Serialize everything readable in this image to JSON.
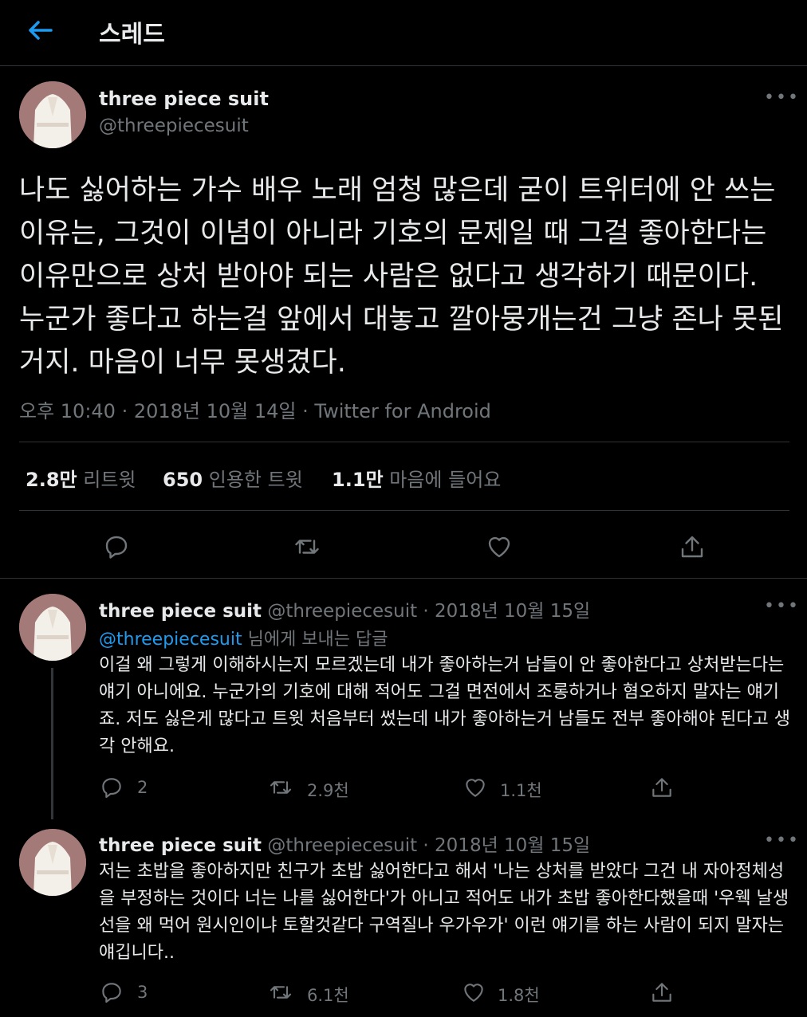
{
  "header": {
    "title": "스레드"
  },
  "main_tweet": {
    "name": "three piece suit",
    "handle": "@threepiecesuit",
    "text": "나도 싫어하는 가수 배우 노래 엄청 많은데 굳이 트위터에 안 쓰는 이유는, 그것이 이념이 아니라 기호의 문제일 때 그걸 좋아한다는 이유만으로 상처 받아야 되는 사람은 없다고 생각하기 때문이다. 누군가 좋다고 하는걸 앞에서 대놓고 깔아뭉개는건 그냥 존나 못된거지. 마음이 너무 못생겼다.",
    "meta": "오후 10:40 · 2018년 10월 14일 · Twitter for Android",
    "retweets_num": "2.8만",
    "retweets_label": "리트윗",
    "quotes_num": "650",
    "quotes_label": "인용한 트윗",
    "likes_num": "1.1만",
    "likes_label": "마음에 들어요"
  },
  "replies": [
    {
      "name": "three piece suit",
      "handle_date": "@threepiecesuit · 2018년 10월 15일",
      "reply_to_handle": "@threepiecesuit",
      "reply_to_suffix": "님에게 보내는 답글",
      "text": "이걸 왜 그렇게 이해하시는지 모르겠는데 내가 좋아하는거 남들이 안 좋아한다고 상처받는다는 얘기 아니에요. 누군가의 기호에 대해 적어도 그걸 면전에서 조롱하거나 혐오하지 말자는 얘기죠. 저도 싫은게 많다고 트윗 처음부터 썼는데 내가 좋아하는거 남들도 전부 좋아해야 된다고 생각 안해요.",
      "reply_count": "2",
      "retweet_count": "2.9천",
      "like_count": "1.1천"
    },
    {
      "name": "three piece suit",
      "handle_date": "@threepiecesuit · 2018년 10월 15일",
      "text": "저는 초밥을 좋아하지만 친구가 초밥 싫어한다고 해서 '나는 상처를 받았다 그건 내 자아정체성을 부정하는 것이다 너는 나를 싫어한다'가 아니고 적어도 내가 초밥 좋아한다했을때 '우웩 날생선을 왜 먹어 원시인이냐 토할것같다 구역질나 우가우가' 이런 얘기를 하는 사람이 되지 말자는 얘깁니다..",
      "reply_count": "3",
      "retweet_count": "6.1천",
      "like_count": "1.8천"
    }
  ],
  "icons": [
    "back-arrow-icon",
    "more-icon",
    "reply-icon",
    "retweet-icon",
    "like-icon",
    "share-icon"
  ],
  "colors": {
    "background": "#000000",
    "text": "#e7e9ea",
    "muted": "#71767b",
    "link": "#1d9bf0",
    "divider": "#2f3336"
  }
}
